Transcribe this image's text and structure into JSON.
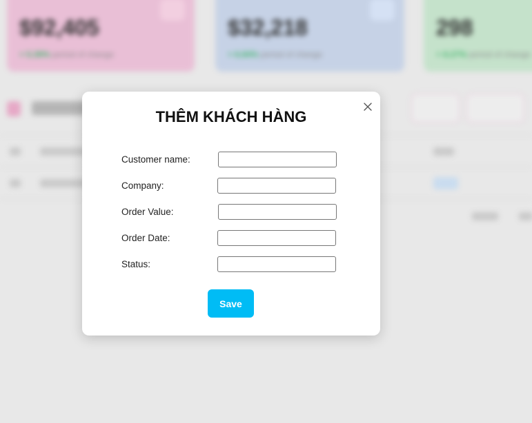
{
  "modal": {
    "title": "THÊM KHÁCH HÀNG",
    "close_icon": "close-icon",
    "fields": [
      {
        "label": "Customer name:",
        "value": "",
        "placeholder": ""
      },
      {
        "label": "Company:",
        "value": "",
        "placeholder": ""
      },
      {
        "label": "Order Value:",
        "value": "",
        "placeholder": ""
      },
      {
        "label": "Order Date:",
        "value": "",
        "placeholder": ""
      },
      {
        "label": "Status:",
        "value": "",
        "placeholder": ""
      }
    ],
    "save_label": "Save"
  },
  "colors": {
    "save_button": "#00bcf5",
    "overlay_background": "#e8e8e8",
    "card_pink": "#e9bfd6",
    "card_blue": "#c6d2e6",
    "card_green": "#c5e2cb"
  },
  "background": {
    "cards": [
      {
        "value": "$92,405",
        "change": "+ 5.39%",
        "change_text": "period of change"
      },
      {
        "value": "$32,218",
        "change": "+ 6.84%",
        "change_text": "period of change"
      },
      {
        "value": "298",
        "change": "+ 8.27%",
        "change_text": "period of change"
      }
    ]
  }
}
